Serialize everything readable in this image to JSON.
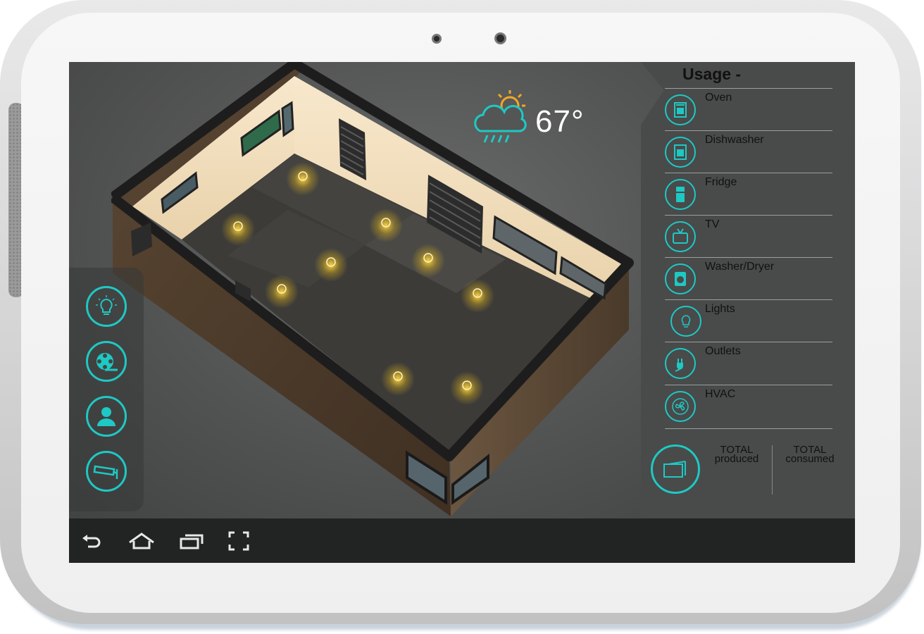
{
  "weather": {
    "temperature": "67°",
    "icon": "partly-cloudy-rain-icon"
  },
  "left_dock": [
    {
      "name": "lights-mode",
      "icon": "lightbulb-icon"
    },
    {
      "name": "media-mode",
      "icon": "film-reel-icon"
    },
    {
      "name": "user-mode",
      "icon": "user-icon"
    },
    {
      "name": "security-mode",
      "icon": "security-camera-icon"
    }
  ],
  "usage": {
    "title": "Usage -",
    "items": [
      {
        "label": "Oven",
        "icon": "oven-icon"
      },
      {
        "label": "Dishwasher",
        "icon": "dishwasher-icon"
      },
      {
        "label": "Fridge",
        "icon": "fridge-icon"
      },
      {
        "label": "TV",
        "icon": "tv-icon"
      },
      {
        "label": "Washer/Dryer",
        "icon": "washer-icon"
      },
      {
        "label": "Lights",
        "icon": "lightbulb-icon"
      },
      {
        "label": "Outlets",
        "icon": "plug-icon"
      },
      {
        "label": "HVAC",
        "icon": "fan-icon"
      }
    ],
    "total_produced": [
      "TOTAL",
      "produced"
    ],
    "total_consumed": [
      "TOTAL",
      "consumed"
    ]
  },
  "navbar": [
    {
      "name": "back",
      "icon": "back-arrow-icon"
    },
    {
      "name": "home",
      "icon": "home-icon"
    },
    {
      "name": "recent-apps",
      "icon": "recent-apps-icon"
    },
    {
      "name": "fullscreen",
      "icon": "fullscreen-icon"
    }
  ],
  "colors": {
    "accent": "#1ec9c4",
    "sun": "#f5a623",
    "light_glow": "#f2c21b"
  },
  "room_lights_count": 9
}
